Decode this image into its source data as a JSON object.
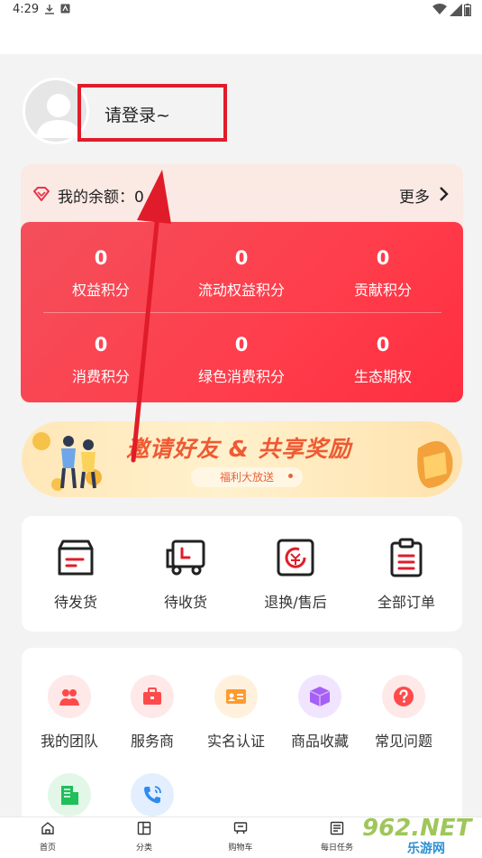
{
  "status_bar": {
    "time": "4:29"
  },
  "profile": {
    "login_prompt": "请登录~"
  },
  "balance": {
    "label": "我的余额：0",
    "more": "更多"
  },
  "points": [
    {
      "value": "0",
      "label": "权益积分"
    },
    {
      "value": "0",
      "label": "流动权益积分"
    },
    {
      "value": "0",
      "label": "贡献积分"
    },
    {
      "value": "0",
      "label": "消费积分"
    },
    {
      "value": "0",
      "label": "绿色消费积分"
    },
    {
      "value": "0",
      "label": "生态期权"
    }
  ],
  "banner": {
    "title": "邀请好友 & 共享奖励",
    "subtitle": "福利大放送"
  },
  "orders": [
    {
      "label": "待发货",
      "icon": "box-icon"
    },
    {
      "label": "待收货",
      "icon": "truck-icon"
    },
    {
      "label": "退换/售后",
      "icon": "refund-icon"
    },
    {
      "label": "全部订单",
      "icon": "clipboard-icon"
    }
  ],
  "services": [
    {
      "label": "我的团队",
      "icon": "team-icon",
      "color": "#ff4a4a"
    },
    {
      "label": "服务商",
      "icon": "briefcase-icon",
      "color": "#ff4a4a"
    },
    {
      "label": "实名认证",
      "icon": "id-card-icon",
      "color": "#ff9a2e"
    },
    {
      "label": "商品收藏",
      "icon": "cube-icon",
      "color": "#a560f5"
    },
    {
      "label": "常见问题",
      "icon": "question-icon",
      "color": "#ff4a4a"
    },
    {
      "label": "",
      "icon": "building-icon",
      "color": "#1fbf5a"
    },
    {
      "label": "",
      "icon": "phone-icon",
      "color": "#2f8bf0"
    }
  ],
  "tabbar": [
    {
      "label": "首页",
      "icon": "home-icon"
    },
    {
      "label": "分类",
      "icon": "category-icon"
    },
    {
      "label": "购物车",
      "icon": "cart-icon"
    },
    {
      "label": "每日任务",
      "icon": "task-icon"
    }
  ],
  "watermark": {
    "text": "962.NET",
    "sub": "乐游网"
  }
}
